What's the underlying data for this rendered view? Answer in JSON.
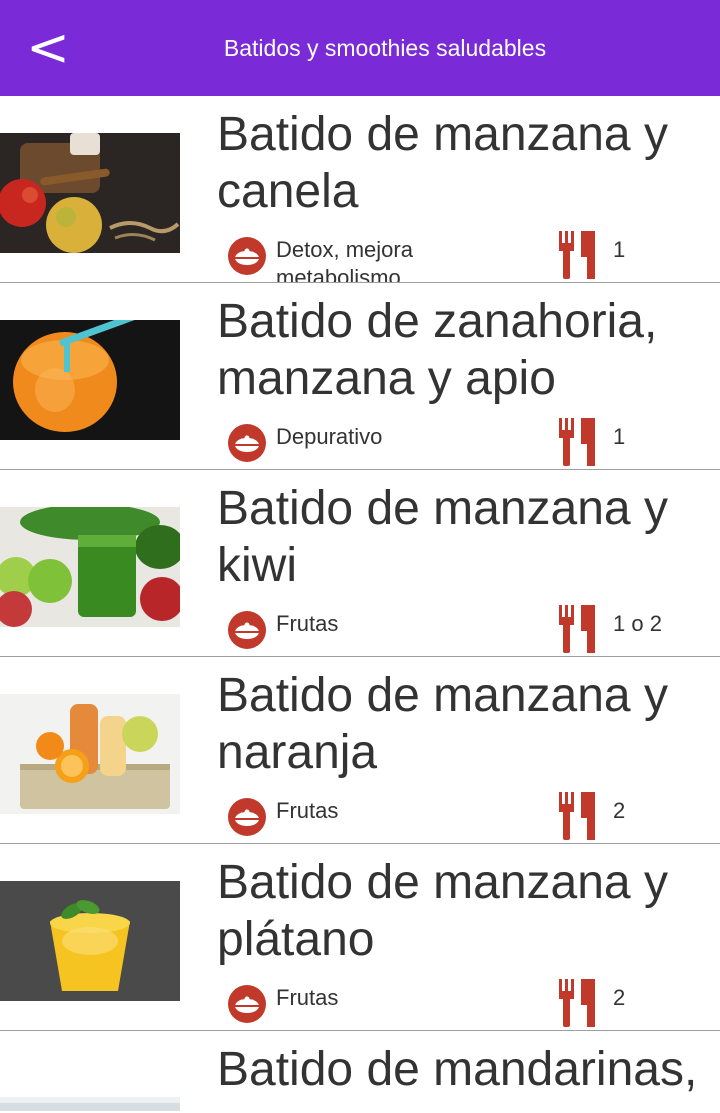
{
  "header": {
    "back_label": "<",
    "title": "Batidos y smoothies saludables"
  },
  "recipes": [
    {
      "title": "Batido de manzana y canela",
      "category": "Detox, mejora metabolismo",
      "servings": "1"
    },
    {
      "title": "Batido de zanahoria, manzana y apio",
      "category": "Depurativo",
      "servings": "1"
    },
    {
      "title": "Batido de manzana y kiwi",
      "category": "Frutas",
      "servings": "1 o 2"
    },
    {
      "title": "Batido de manzana y naranja",
      "category": "Frutas",
      "servings": "2"
    },
    {
      "title": "Batido de manzana y plátano",
      "category": "Frutas",
      "servings": "2"
    },
    {
      "title": "Batido de mandarinas,",
      "category": "",
      "servings": ""
    }
  ],
  "colors": {
    "appbar": "#7a2ad6",
    "accent_icon": "#c0392b",
    "text": "#333333",
    "divider": "#9e9e9e"
  },
  "icons": {
    "back": "back-arrow-icon",
    "category": "food-bowl-icon",
    "servings": "fork-knife-icon"
  }
}
